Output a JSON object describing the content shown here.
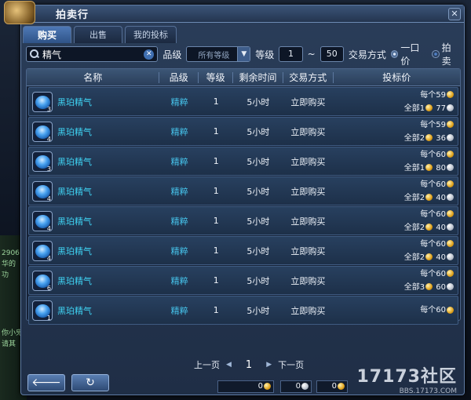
{
  "window": {
    "title": "拍卖行"
  },
  "tabs": [
    {
      "label": "购买",
      "active": true
    },
    {
      "label": "出售",
      "active": false
    },
    {
      "label": "我的投标",
      "active": false
    }
  ],
  "filter": {
    "search_value": "精气",
    "grade_label": "品级",
    "grade_placeholder": "所有等级",
    "level_label": "等级",
    "level_min": "1",
    "level_sep": "~",
    "level_max": "50",
    "trade_label": "交易方式",
    "trade_options": [
      "一口价",
      "拍卖"
    ]
  },
  "table": {
    "headers": [
      "名称",
      "品级",
      "等级",
      "剩余时间",
      "交易方式",
      "投标价"
    ],
    "rows": [
      {
        "count": "3",
        "name": "黑珀精气",
        "grade": "精粹",
        "level": "1",
        "time": "5小时",
        "mode": "立即购买",
        "each": "每个59",
        "total": "全部1",
        "total_val": "77"
      },
      {
        "count": "4",
        "name": "黑珀精气",
        "grade": "精粹",
        "level": "1",
        "time": "5小时",
        "mode": "立即购买",
        "each": "每个59",
        "total": "全部2",
        "total_val": "36"
      },
      {
        "count": "3",
        "name": "黑珀精气",
        "grade": "精粹",
        "level": "1",
        "time": "5小时",
        "mode": "立即购买",
        "each": "每个60",
        "total": "全部1",
        "total_val": "80"
      },
      {
        "count": "4",
        "name": "黑珀精气",
        "grade": "精粹",
        "level": "1",
        "time": "5小时",
        "mode": "立即购买",
        "each": "每个60",
        "total": "全部2",
        "total_val": "40"
      },
      {
        "count": "4",
        "name": "黑珀精气",
        "grade": "精粹",
        "level": "1",
        "time": "5小时",
        "mode": "立即购买",
        "each": "每个60",
        "total": "全部2",
        "total_val": "40"
      },
      {
        "count": "4",
        "name": "黑珀精气",
        "grade": "精粹",
        "level": "1",
        "time": "5小时",
        "mode": "立即购买",
        "each": "每个60",
        "total": "全部2",
        "total_val": "40"
      },
      {
        "count": "6",
        "name": "黑珀精气",
        "grade": "精粹",
        "level": "1",
        "time": "5小时",
        "mode": "立即购买",
        "each": "每个60",
        "total": "全部3",
        "total_val": "60"
      },
      {
        "count": "1",
        "name": "黑珀精气",
        "grade": "精粹",
        "level": "1",
        "time": "5小时",
        "mode": "立即购买",
        "each": "每个60",
        "total": "",
        "total_val": ""
      }
    ]
  },
  "pager": {
    "prev": "上一页",
    "page": "1",
    "next": "下一页"
  },
  "bottom": {
    "back_icon": "back-arrow-icon",
    "refresh_icon": "refresh-icon",
    "money": [
      "0",
      "0",
      "0"
    ]
  },
  "side_chat": [
    "2906",
    "华的",
    "功",
    "你小鬼",
    "请其"
  ],
  "watermark": {
    "brand": "17173社区",
    "url": "BBS.17173.COM"
  }
}
